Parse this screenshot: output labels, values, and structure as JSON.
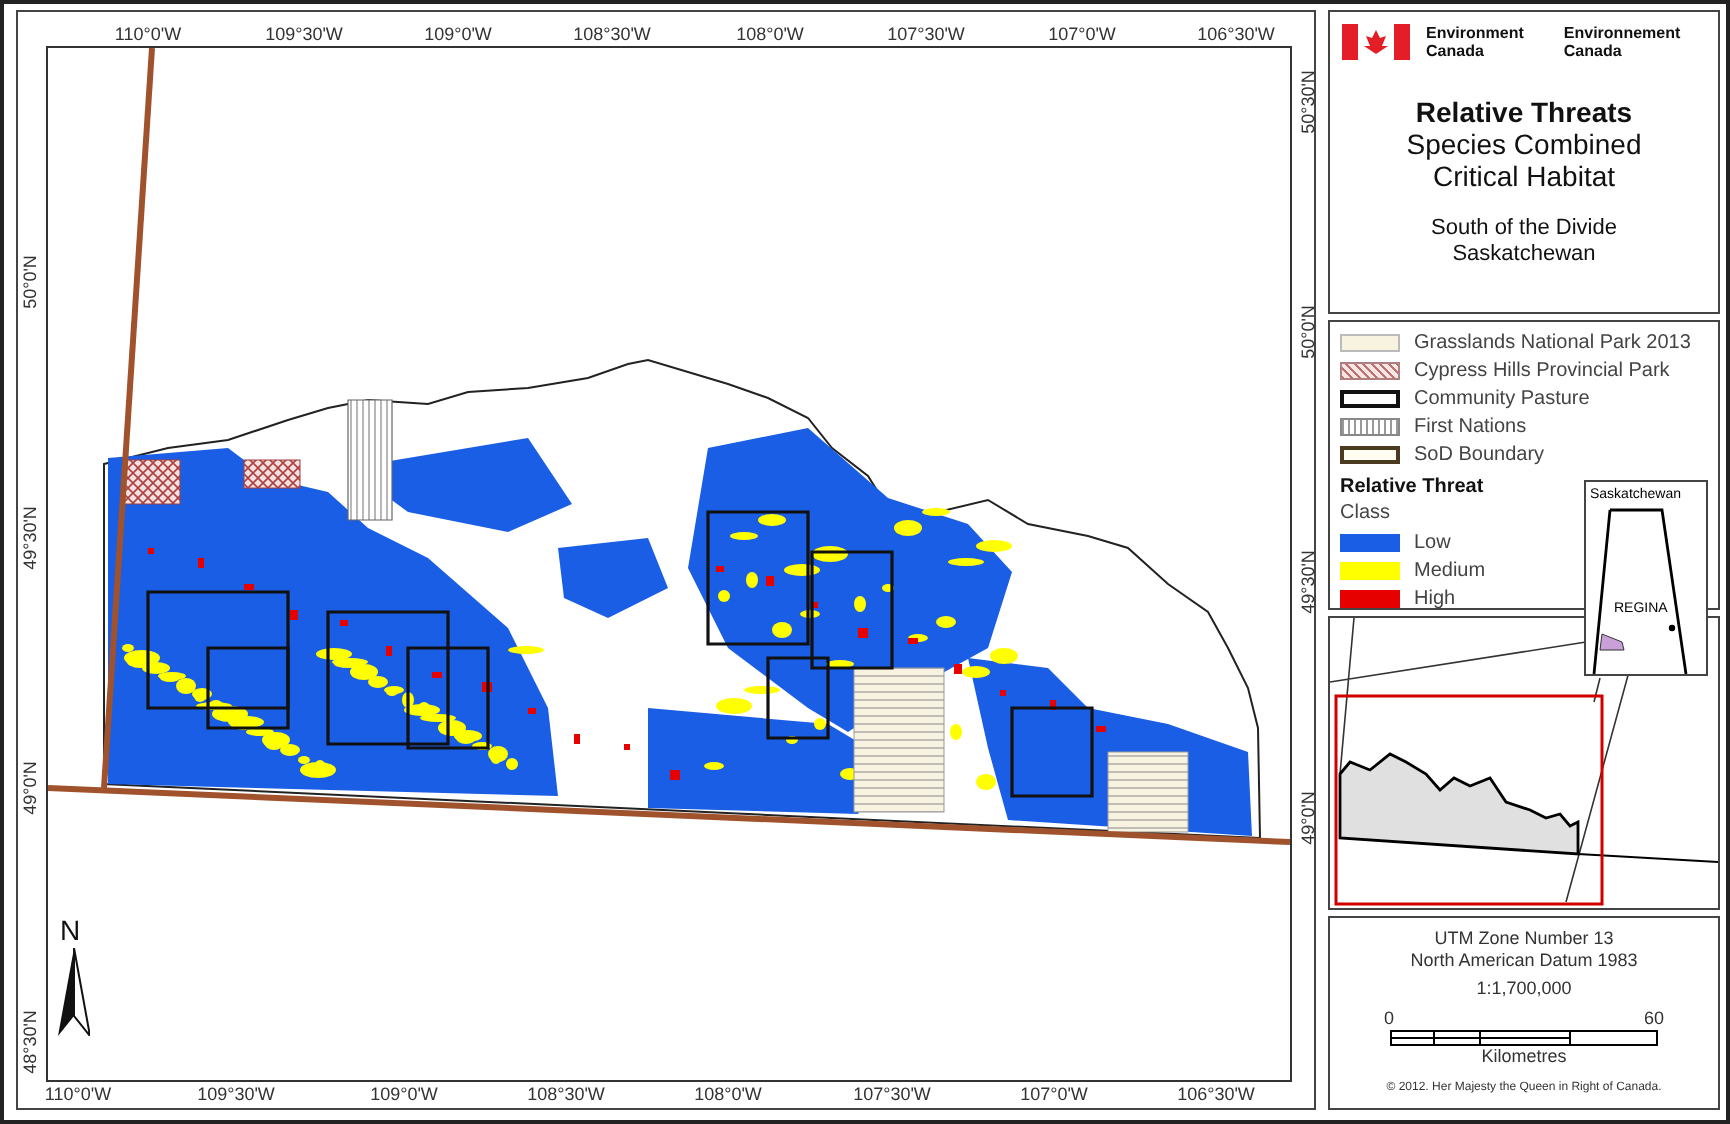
{
  "map": {
    "top_labels": [
      "110°0'W",
      "109°30'W",
      "109°0'W",
      "108°30'W",
      "108°0'W",
      "107°30'W",
      "107°0'W",
      "106°30'W"
    ],
    "bottom_labels": [
      "110°0'W",
      "109°30'W",
      "109°0'W",
      "108°30'W",
      "108°0'W",
      "107°30'W",
      "107°0'W",
      "106°30'W"
    ],
    "left_labels": [
      "50°0'N",
      "49°30'N",
      "49°0'N",
      "48°30'N"
    ],
    "right_labels": [
      "50°30'N",
      "50°0'N",
      "49°30'N",
      "49°0'N"
    ],
    "north_label": "N"
  },
  "title_block": {
    "agency_en": "Environment Canada",
    "agency_fr": "Environnement Canada",
    "title": "Relative Threats",
    "subtitle": [
      "Species Combined",
      "Critical Habitat"
    ],
    "region": [
      "South of the Divide",
      "Saskatchewan"
    ]
  },
  "legend": {
    "items": [
      {
        "kind": "cream-fill",
        "label": "Grasslands National Park 2013"
      },
      {
        "kind": "crosshatch",
        "label": "Cypress Hills Provincial Park"
      },
      {
        "kind": "bold-outline",
        "label": "Community Pasture"
      },
      {
        "kind": "vertical-lines",
        "label": "First Nations"
      },
      {
        "kind": "cream-outline",
        "label": "SoD Boundary"
      }
    ],
    "heading": "Relative Threat",
    "class_label": "Class",
    "classes": [
      {
        "label": "Low",
        "color": "#1a5ee6"
      },
      {
        "label": "Medium",
        "color": "#ffff00"
      },
      {
        "label": "High",
        "color": "#e60000"
      }
    ]
  },
  "inset": {
    "province_label": "Saskatchewan",
    "city_label": "REGINA"
  },
  "info": {
    "lines": [
      "UTM Zone Number 13",
      "North American Datum 1983"
    ],
    "scale_ratio": "1:1,700,000",
    "scale_start": "0",
    "scale_end": "60",
    "scale_unit": "Kilometres",
    "copyright": "© 2012. Her Majesty the Queen in Right of Canada."
  }
}
